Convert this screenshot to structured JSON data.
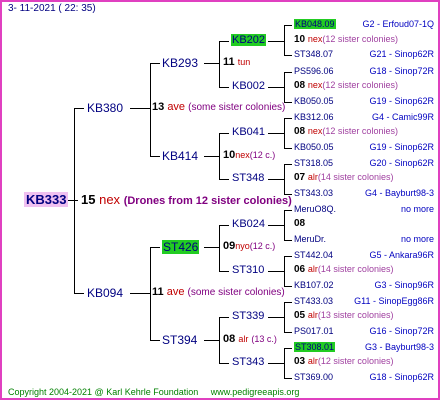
{
  "header": {
    "datetime": "3- 11-2021 ( 22: 35)"
  },
  "root": {
    "id": "KB333",
    "num": "15",
    "queen": "nex",
    "note": "(Drones from 12 sister colonies)"
  },
  "gen1": [
    {
      "id": "KB380",
      "num": "13",
      "queen": "ave",
      "note": "(some sister colonies)"
    },
    {
      "id": "KB094",
      "num": "11",
      "queen": "ave",
      "note": "(some sister colonies)"
    }
  ],
  "gen2": [
    {
      "id": "KB293",
      "num": "11",
      "queen": "tun",
      "note": ""
    },
    {
      "id": "KB414",
      "num": "10",
      "queen": "nex",
      "note": "(12 c.)"
    },
    {
      "id": "ST426",
      "num": "09",
      "queen": "nyo",
      "note": "(12 c.)"
    },
    {
      "id": "ST394",
      "num": "08",
      "queen": "alr",
      "note": "(13 c.)"
    }
  ],
  "gen3": [
    {
      "id": "KB202",
      "num": "10",
      "queen": "nex",
      "note": "(12 sister colonies)"
    },
    {
      "id": "KB002",
      "num": "08",
      "queen": "nex",
      "note": "(12 sister colonies)"
    },
    {
      "id": "KB041",
      "num": "08",
      "queen": "nex",
      "note": "(12 sister colonies)"
    },
    {
      "id": "ST348",
      "num": "07",
      "queen": "alr",
      "note": "(14 sister colonies)"
    },
    {
      "id": "KB024",
      "num": "08",
      "queen": "",
      "note": ""
    },
    {
      "id": "ST310",
      "num": "06",
      "queen": "alr",
      "note": "(14 sister colonies)"
    },
    {
      "id": "ST339",
      "num": "05",
      "queen": "alr",
      "note": "(13 sister colonies)"
    },
    {
      "id": "ST343",
      "num": "03",
      "queen": "alr",
      "note": "(12 sister colonies)"
    }
  ],
  "gen4": [
    {
      "id": "KB048.09",
      "pedigree": "G2 - Erfoud07-1Q"
    },
    {
      "id": "ST348.07",
      "pedigree": "G21 - Sinop62R"
    },
    {
      "id": "PS596.06",
      "pedigree": "G18 - Sinop72R"
    },
    {
      "id": "KB050.05",
      "pedigree": "G19 - Sinop62R"
    },
    {
      "id": "KB312.06",
      "pedigree": "G4 - Camic99R"
    },
    {
      "id": "KB050.05",
      "pedigree": "G19 - Sinop62R"
    },
    {
      "id": "ST318.05",
      "pedigree": "G20 - Sinop62R"
    },
    {
      "id": "ST343.03",
      "pedigree": "G4 - Bayburt98-3"
    },
    {
      "id": "MeruO8Q.",
      "pedigree": "no more"
    },
    {
      "id": "MeruDr.",
      "pedigree": "no more"
    },
    {
      "id": "ST442.04",
      "pedigree": "G5 - Ankara96R"
    },
    {
      "id": "KB107.02",
      "pedigree": "G3 - Sinop96R"
    },
    {
      "id": "ST433.03",
      "pedigree": "G11 - SinopEgg86R"
    },
    {
      "id": "PS017.01",
      "pedigree": "G16 - Sinop72R"
    },
    {
      "id": "ST308.01",
      "pedigree": "G3 - Bayburt98-3"
    },
    {
      "id": "ST369.00",
      "pedigree": "G18 - Sinop62R"
    }
  ],
  "footer": {
    "copyright": "Copyright 2004-2021 @ Karl Kehrle Foundation",
    "site": "www.pedigreeapis.org"
  },
  "colors": {
    "border": "#e040c0",
    "highlight": "#22cc22",
    "root_bg": "#f0c0f0",
    "link": "#000080",
    "queen": "#c00000",
    "note": "#800080"
  }
}
